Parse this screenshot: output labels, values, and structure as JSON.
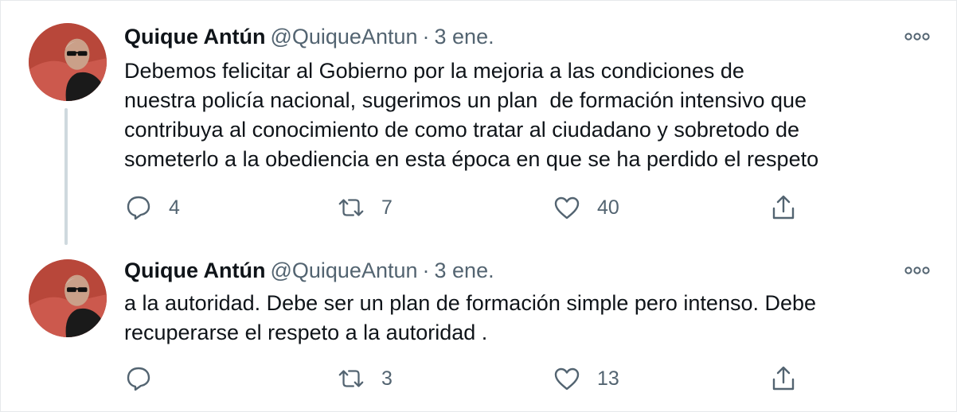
{
  "thread": {
    "tweets": [
      {
        "author_name": "Quique Antún",
        "handle": "@QuiqueAntun",
        "separator": "·",
        "date": "3 ene.",
        "text_lines": [
          "Debemos felicitar al Gobierno por la mejoria a las condiciones de",
          "nuestra policía nacional, sugerimos un plan  de formación intensivo que",
          "contribuya al conocimiento de como tratar al ciudadano y sobretodo de",
          "someterlo a la obediencia en esta época en que se ha perdido el respeto"
        ],
        "replies": "4",
        "retweets": "7",
        "likes": "40"
      },
      {
        "author_name": "Quique Antún",
        "handle": "@QuiqueAntun",
        "separator": "·",
        "date": "3 ene.",
        "text_lines": [
          "a la autoridad. Debe ser un plan de formación simple pero intenso. Debe",
          "recuperarse el respeto a la autoridad ."
        ],
        "replies": "",
        "retweets": "3",
        "likes": "13"
      }
    ]
  },
  "icons": {
    "more": "more-options-icon",
    "reply": "reply-bubble-icon",
    "retweet": "retweet-icon",
    "like": "heart-icon",
    "share": "share-icon"
  },
  "colors": {
    "text_primary": "#0f1419",
    "text_secondary": "#536471",
    "thread_line": "#cfd9de",
    "border": "#e6e9eb"
  }
}
